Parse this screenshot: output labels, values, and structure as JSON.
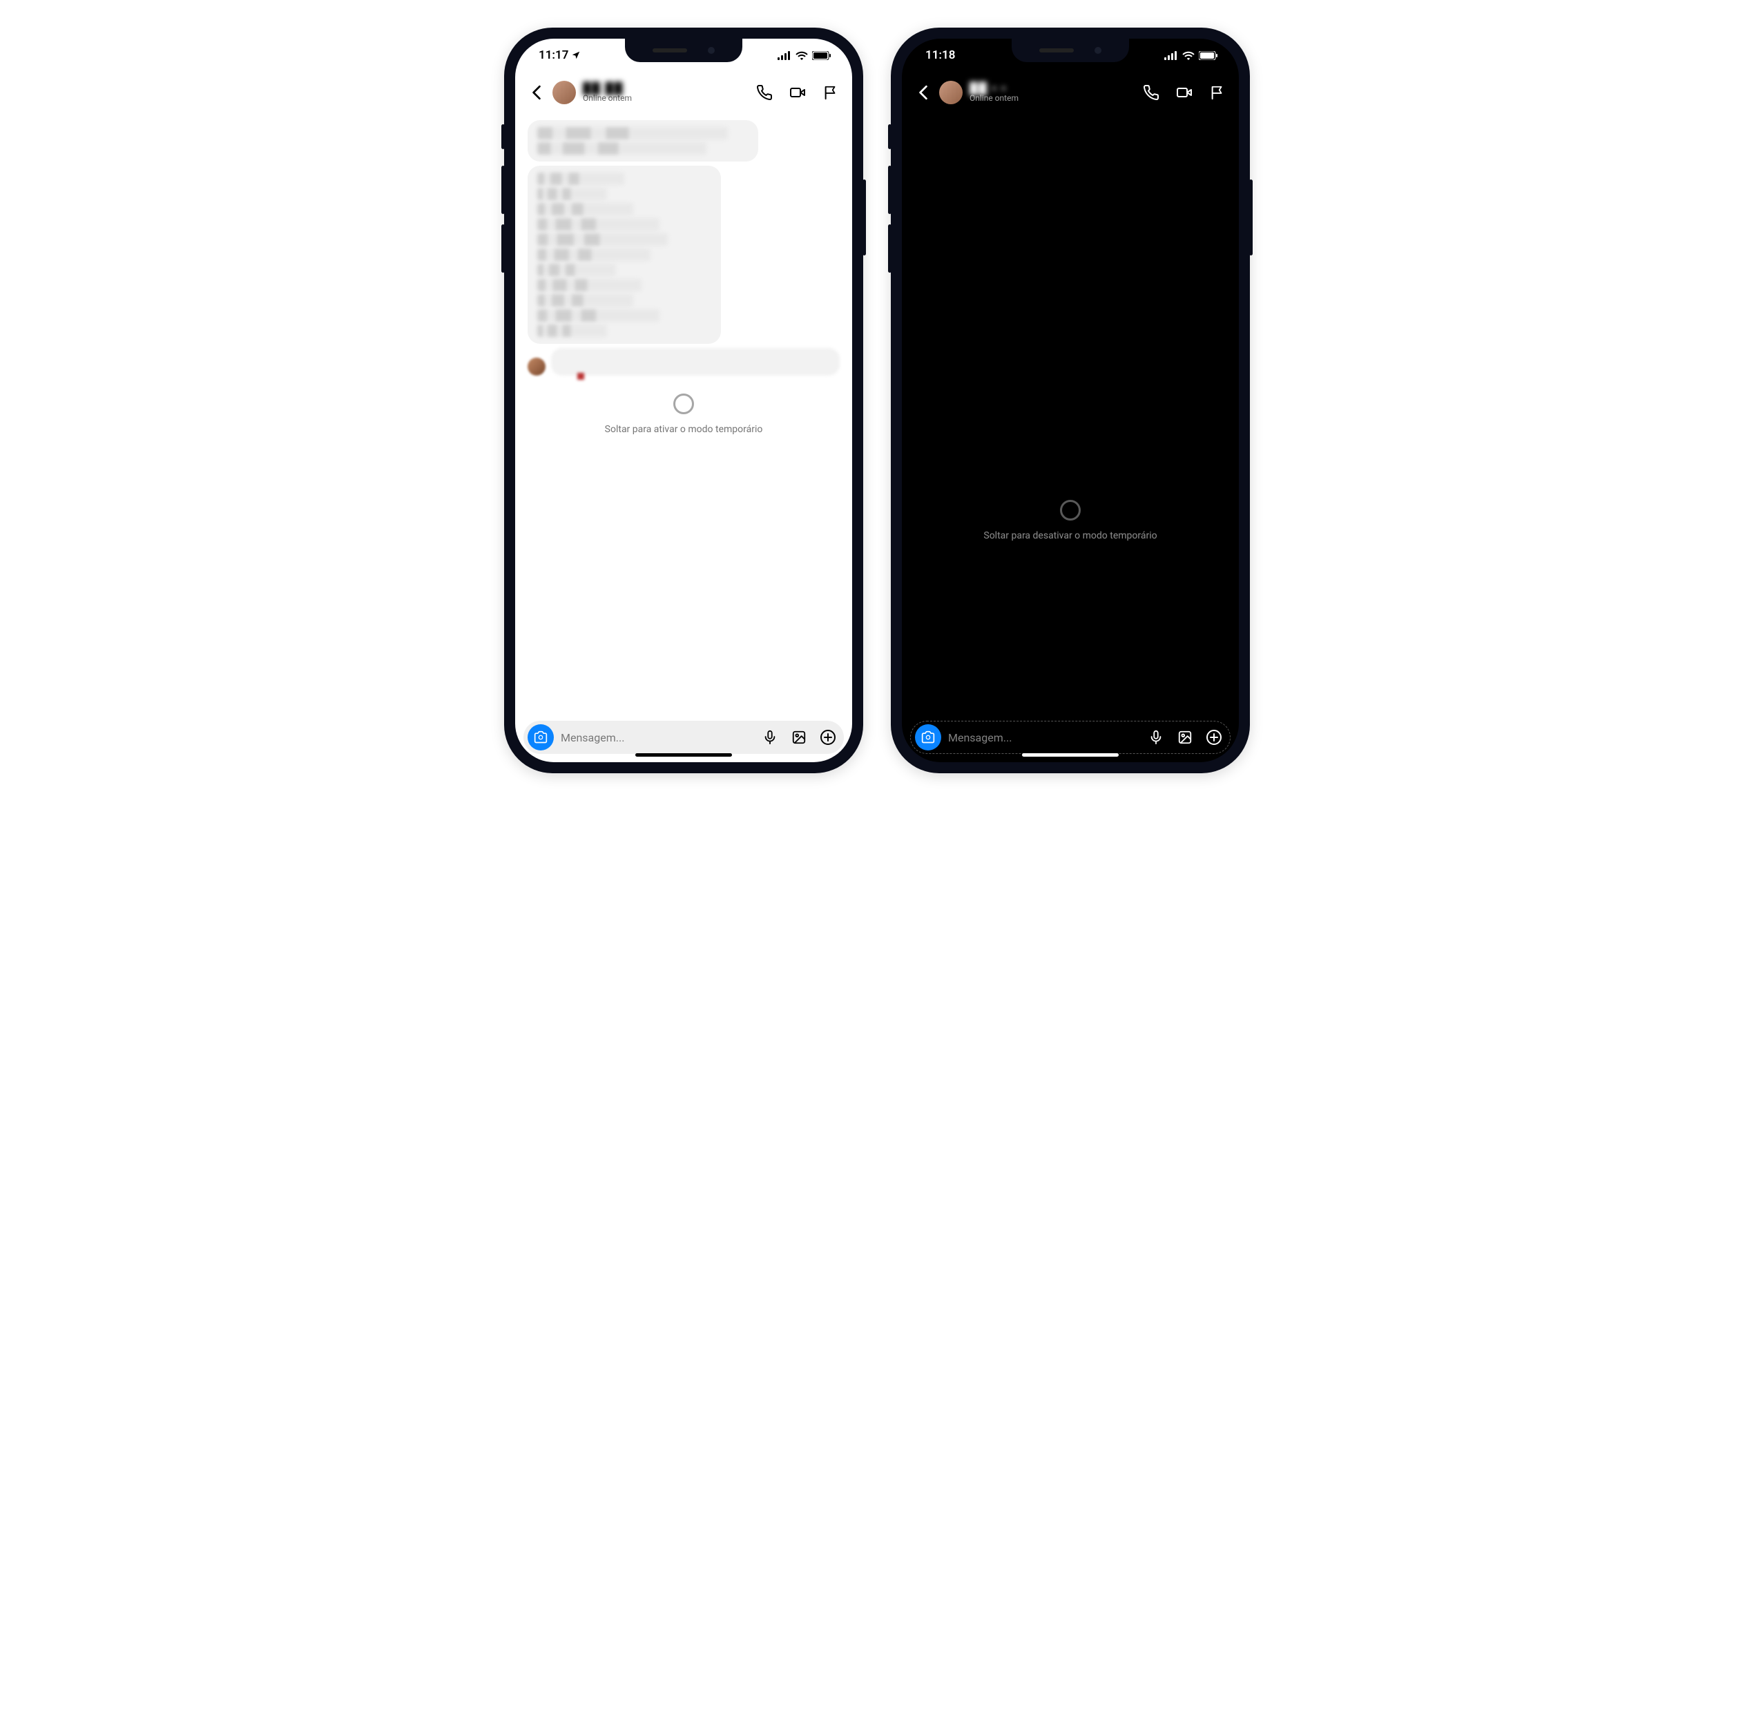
{
  "phones": {
    "light": {
      "status": {
        "time": "11:17",
        "show_location_arrow": true
      },
      "header": {
        "name_blurred": "██ ██",
        "subtitle": "Online ontem"
      },
      "pull_hint": "Soltar para ativar o modo temporário",
      "composer": {
        "placeholder": "Mensagem..."
      }
    },
    "dark": {
      "status": {
        "time": "11:18",
        "show_location_arrow": false
      },
      "header": {
        "name_blurred": "██  ▪ ▪",
        "subtitle": "Online ontem"
      },
      "pull_hint": "Soltar para desativar o modo temporário",
      "composer": {
        "placeholder": "Mensagem..."
      }
    }
  },
  "icons": {
    "back": "chevron-left",
    "call": "phone",
    "video": "video",
    "flag": "flag",
    "camera": "camera",
    "mic": "mic",
    "gallery": "image",
    "plus": "plus-circle"
  }
}
